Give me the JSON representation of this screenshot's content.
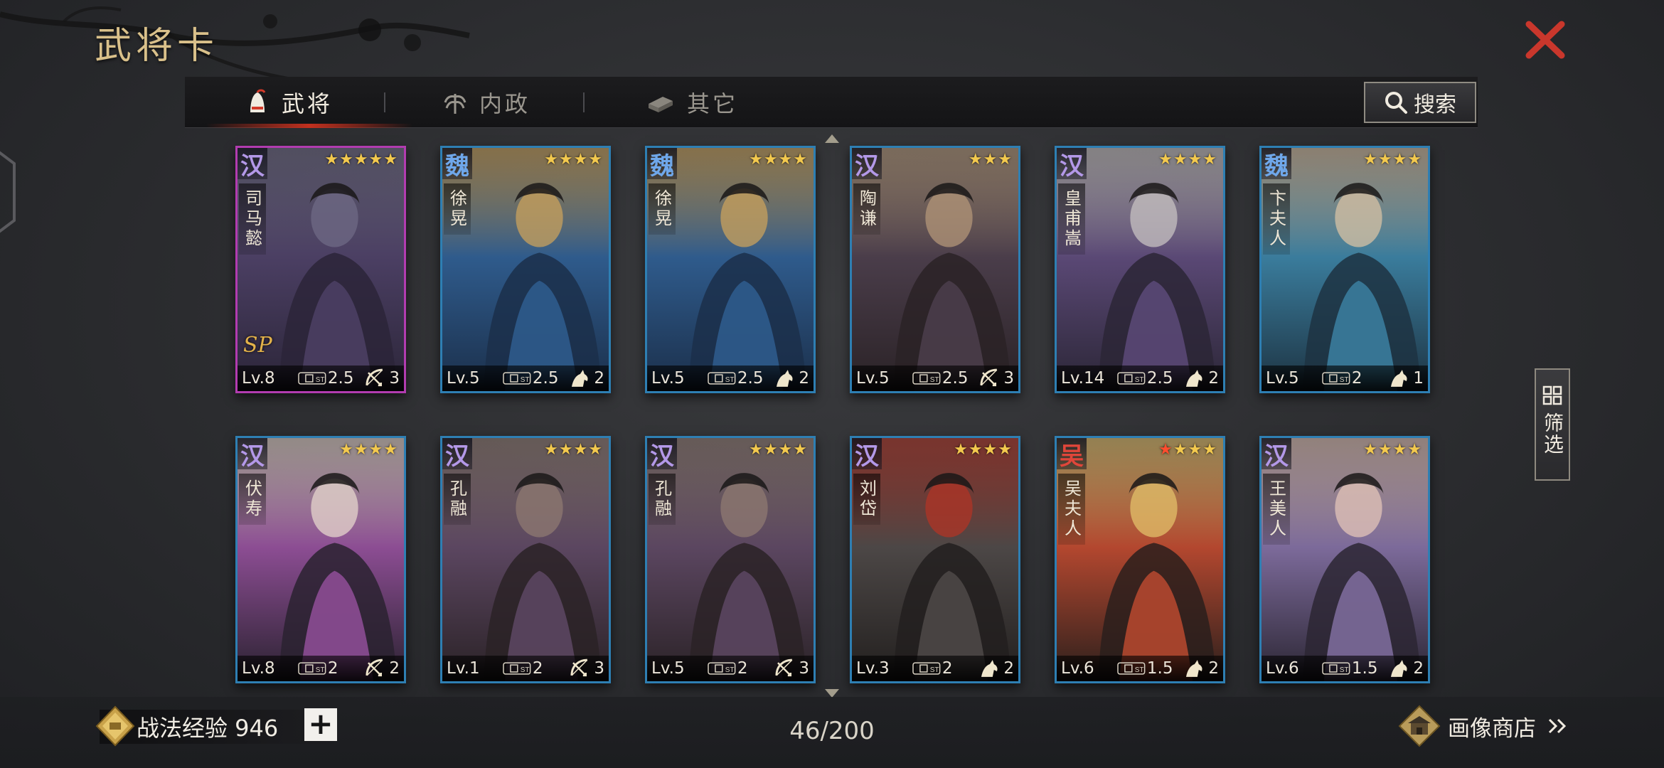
{
  "header": {
    "title": "武将卡"
  },
  "tabs": [
    {
      "label": "武将",
      "active": true
    },
    {
      "label": "内政",
      "active": false
    },
    {
      "label": "其它",
      "active": false
    }
  ],
  "search": {
    "label": "搜索"
  },
  "filter": {
    "label": "筛选"
  },
  "cards": [
    {
      "faction": "汉",
      "name": "司马懿",
      "stars": "★★★★★",
      "level": "Lv.8",
      "cost": "2.5",
      "unit": "bow",
      "unit_count": "3",
      "sp": true,
      "sp_label": "SP",
      "red_star": false,
      "palette": [
        "#4b3f63",
        "#2b2538",
        "#6f6a86"
      ]
    },
    {
      "faction": "魏",
      "name": "徐晃",
      "stars": "★★★★",
      "level": "Lv.5",
      "cost": "2.5",
      "unit": "horse",
      "unit_count": "2",
      "sp": false,
      "red_star": false,
      "palette": [
        "#2f5b8c",
        "#1b2f4a",
        "#c9a25c"
      ]
    },
    {
      "faction": "魏",
      "name": "徐晃",
      "stars": "★★★★",
      "level": "Lv.5",
      "cost": "2.5",
      "unit": "horse",
      "unit_count": "2",
      "sp": false,
      "red_star": false,
      "palette": [
        "#2f5b8c",
        "#1b2f4a",
        "#c9a25c"
      ]
    },
    {
      "faction": "汉",
      "name": "陶谦",
      "stars": "★★★",
      "level": "Lv.5",
      "cost": "2.5",
      "unit": "bow",
      "unit_count": "3",
      "sp": false,
      "red_star": false,
      "palette": [
        "#4a3d4a",
        "#2a2226",
        "#b39678"
      ]
    },
    {
      "faction": "汉",
      "name": "皇甫嵩",
      "stars": "★★★★",
      "level": "Lv.14",
      "cost": "2.5",
      "unit": "horse",
      "unit_count": "2",
      "sp": false,
      "red_star": false,
      "palette": [
        "#5a4875",
        "#2b2636",
        "#c7c2c2"
      ]
    },
    {
      "faction": "魏",
      "name": "卞夫人",
      "stars": "★★★★",
      "level": "Lv.5",
      "cost": "2",
      "unit": "horse",
      "unit_count": "1",
      "sp": false,
      "red_star": false,
      "palette": [
        "#3a7c9c",
        "#1d3342",
        "#d7c1a4"
      ]
    },
    {
      "faction": "汉",
      "name": "伏寿",
      "stars": "★★★★",
      "level": "Lv.8",
      "cost": "2",
      "unit": "bow",
      "unit_count": "2",
      "sp": false,
      "red_star": false,
      "palette": [
        "#8c4d93",
        "#2a2230",
        "#e6d6cc"
      ]
    },
    {
      "faction": "汉",
      "name": "孔融",
      "stars": "★★★★",
      "level": "Lv.1",
      "cost": "2",
      "unit": "bow",
      "unit_count": "3",
      "sp": false,
      "red_star": false,
      "palette": [
        "#5b4660",
        "#2a2226",
        "#8f7a72"
      ]
    },
    {
      "faction": "汉",
      "name": "孔融",
      "stars": "★★★★",
      "level": "Lv.5",
      "cost": "2",
      "unit": "bow",
      "unit_count": "3",
      "sp": false,
      "red_star": false,
      "palette": [
        "#5b4660",
        "#2a2226",
        "#8f7a72"
      ]
    },
    {
      "faction": "汉",
      "name": "刘岱",
      "stars": "★★★★",
      "level": "Lv.3",
      "cost": "2",
      "unit": "horse",
      "unit_count": "2",
      "sp": false,
      "red_star": false,
      "palette": [
        "#4c4746",
        "#221f1e",
        "#b03426"
      ]
    },
    {
      "faction": "吴",
      "name": "吴夫人",
      "stars": "★★★",
      "level": "Lv.6",
      "cost": "1.5",
      "unit": "horse",
      "unit_count": "2",
      "sp": false,
      "red_star": true,
      "palette": [
        "#b3472f",
        "#2a1f1c",
        "#e3c06a"
      ]
    },
    {
      "faction": "汉",
      "name": "王美人",
      "stars": "★★★★",
      "level": "Lv.6",
      "cost": "1.5",
      "unit": "horse",
      "unit_count": "2",
      "sp": false,
      "red_star": false,
      "palette": [
        "#7c6a9a",
        "#2b2633",
        "#e3c4b8"
      ]
    }
  ],
  "footer": {
    "exp_text": "战法经验 946",
    "plus": "+",
    "count": "46/200",
    "shop_label": "画像商店"
  }
}
